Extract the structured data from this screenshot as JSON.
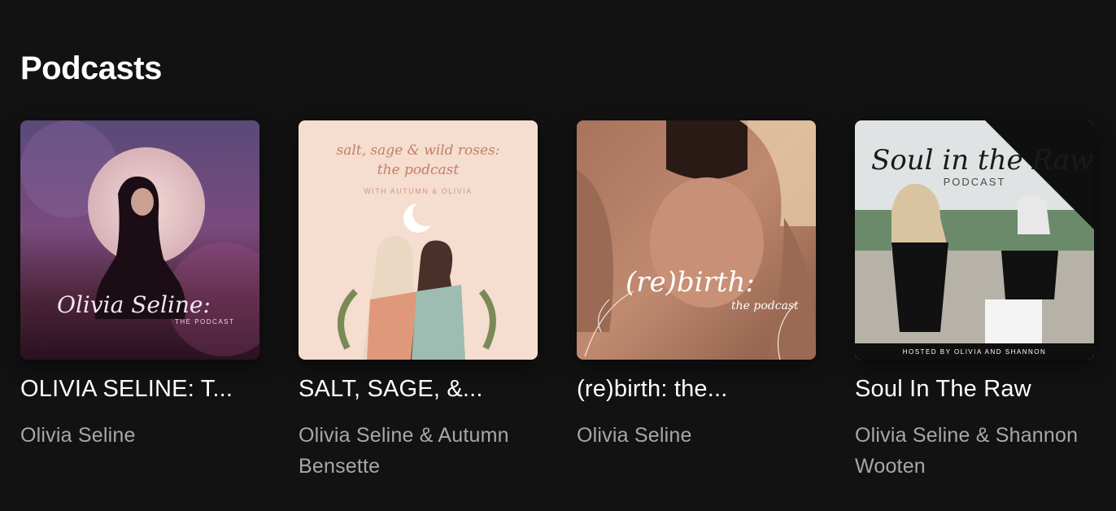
{
  "section": {
    "title": "Podcasts"
  },
  "podcasts": [
    {
      "title": "OLIVIA SELINE: T...",
      "author": "Olivia Seline",
      "cover_text": [
        "Olivia Seline:",
        "THE PODCAST"
      ]
    },
    {
      "title": "SALT, SAGE, &...",
      "author": "Olivia Seline & Autumn Bensette",
      "cover_text": [
        "salt, sage & wild roses:",
        "the podcast",
        "WITH AUTUMN & OLIVIA"
      ]
    },
    {
      "title": "(re)birth: the...",
      "author": "Olivia Seline",
      "cover_text": [
        "(re)birth:",
        "the podcast"
      ]
    },
    {
      "title": "Soul In The Raw",
      "author": "Olivia Seline & Shannon Wooten",
      "cover_text": [
        "Soul in the Raw",
        "PODCAST",
        "HOSTED BY OLIVIA AND SHANNON"
      ]
    }
  ],
  "colors": {
    "background": "#121212",
    "title": "#ffffff",
    "subtitle": "#a7a7a7"
  }
}
